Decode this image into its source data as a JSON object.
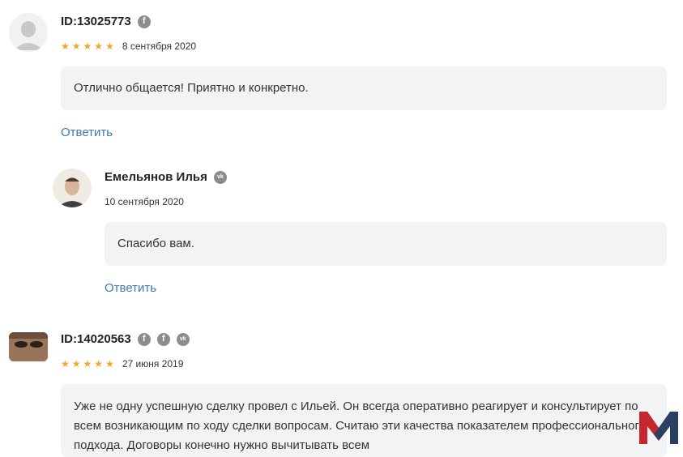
{
  "reviews": [
    {
      "user_id": "ID:13025773",
      "socials": [
        "f"
      ],
      "date": "8 сентября 2020",
      "text": "Отлично общается! Приятно и конкретно.",
      "reply_label": "Ответить"
    },
    {
      "user_name": "Емельянов Илья",
      "socials": [
        "vk"
      ],
      "date": "10 сентября 2020",
      "text": "Спасибо вам.",
      "reply_label": "Ответить"
    },
    {
      "user_id": "ID:14020563",
      "socials": [
        "f",
        "f",
        "vk"
      ],
      "date": "27 июня 2019",
      "text": "Уже не одну успешную сделку провел с Ильей. Он всегда оперативно реагирует и консультирует по всем возникающим по ходу сделки вопросам. Считаю эти качества показателем профессионального подхода. Договоры конечно нужно вычитывать всем"
    }
  ],
  "rating": {
    "stars": 5
  },
  "colors": {
    "star": "#f5a623",
    "link": "#3f78b6",
    "bubble": "#f2f3f5"
  },
  "logo": {
    "letter": "M"
  }
}
